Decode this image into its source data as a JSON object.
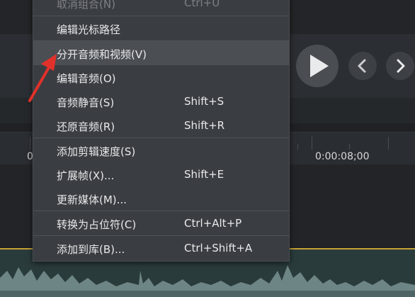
{
  "menu": {
    "items": [
      {
        "label": "取消组合(N)",
        "shortcut": "Ctrl+U"
      },
      {
        "label": "编辑光标路径",
        "shortcut": ""
      },
      {
        "label": "分开音频和视频(V)",
        "shortcut": ""
      },
      {
        "label": "编辑音频(O)",
        "shortcut": ""
      },
      {
        "label": "音频静音(S)",
        "shortcut": "Shift+S"
      },
      {
        "label": "还原音频(R)",
        "shortcut": "Shift+R"
      },
      {
        "label": "添加剪辑速度(S)",
        "shortcut": ""
      },
      {
        "label": "扩展帧(X)...",
        "shortcut": "Shift+E"
      },
      {
        "label": "更新媒体(M)...",
        "shortcut": ""
      },
      {
        "label": "转换为占位符(C)",
        "shortcut": "Ctrl+Alt+P"
      },
      {
        "label": "添加到库(B)...",
        "shortcut": "Ctrl+Shift+A"
      }
    ]
  },
  "timeline": {
    "timecode": "0:00:08;00",
    "partial_left": "0"
  },
  "colors": {
    "menu_bg": "#3a3d41",
    "highlight": "#4b4f54",
    "playhead_track": "#c7a236",
    "arrow": "#e0312a"
  },
  "icons": {
    "play": "play-icon",
    "prev": "chevron-left-icon",
    "next": "chevron-right-icon"
  }
}
